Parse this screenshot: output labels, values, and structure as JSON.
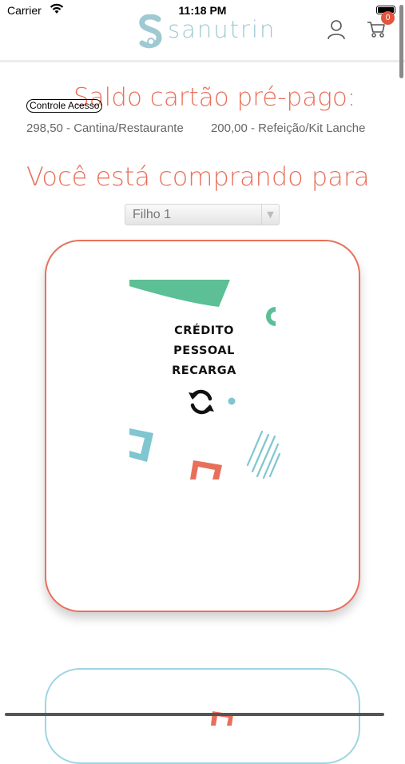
{
  "status_bar": {
    "carrier": "Carrier",
    "time": "11:18 PM"
  },
  "header": {
    "brand": "sanutrin",
    "cart_count": "0",
    "brand_colors": {
      "teal": "#9fc9d3",
      "coral": "#e8705b"
    }
  },
  "saldo": {
    "title": "Saldo cartão pré-pago:",
    "access_button": "Controle Acesso",
    "balances": [
      "298,50 - Cantina/Restaurante",
      "200,00 - Refeição/Kit Lanche"
    ]
  },
  "purchase": {
    "heading": "Você está comprando para",
    "child_select": {
      "value": "Filho 1",
      "options": [
        "Filho 1"
      ]
    }
  },
  "cards": [
    {
      "lines": [
        "CRÉDITO",
        "PESSOAL",
        "RECARGA"
      ],
      "icon": "refresh-icon",
      "border_color": "#e8705b"
    },
    {
      "border_color": "#9dd6e1"
    }
  ]
}
